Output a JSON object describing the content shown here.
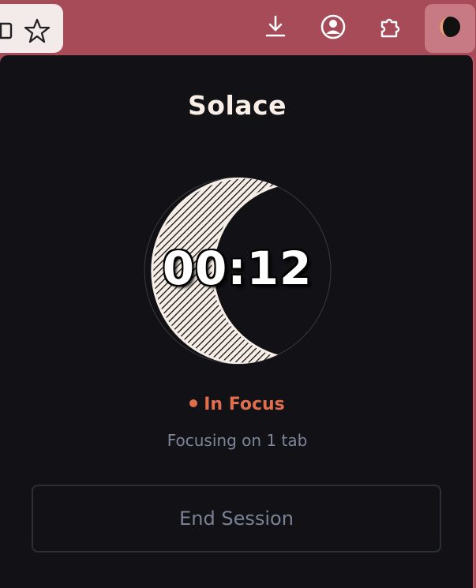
{
  "browser": {
    "icons": {
      "reader": "reader-mode-icon",
      "bookmark": "star-icon",
      "downloads": "download-icon",
      "account": "account-icon",
      "extensions": "puzzle-icon",
      "solace": "moon-logo-icon"
    }
  },
  "popup": {
    "title": "Solace",
    "timer": "00:12",
    "status": "In Focus",
    "subtitle": "Focusing on 1 tab",
    "end_button": "End Session"
  },
  "colors": {
    "toolbar": "#a84b59",
    "popup_bg": "#111116",
    "accent": "#e06e4c",
    "moon_light": "#fbeee6"
  }
}
